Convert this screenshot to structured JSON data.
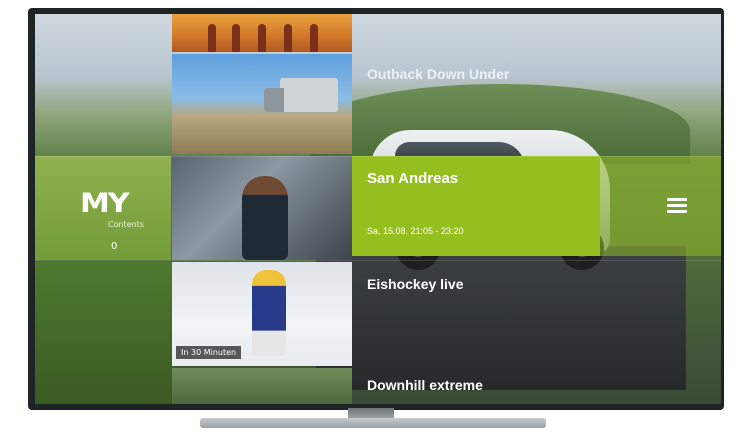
{
  "rows": [
    {
      "title": "Outback Down Under"
    },
    {
      "title": "San Andreas",
      "time": "Sa, 15.08. 21:05 - 23:20"
    },
    {
      "title": "Eishockey live",
      "badge": "In 30 Minuten"
    },
    {
      "title": "Downhill extreme"
    }
  ],
  "my_tile": {
    "logo": "MY",
    "subtitle": "Contents",
    "count": "0"
  },
  "menu_icon": "hamburger-menu-icon",
  "colors": {
    "accent": "#95bf1e",
    "tv_frame": "#1e2326",
    "text": "#ffffff"
  }
}
